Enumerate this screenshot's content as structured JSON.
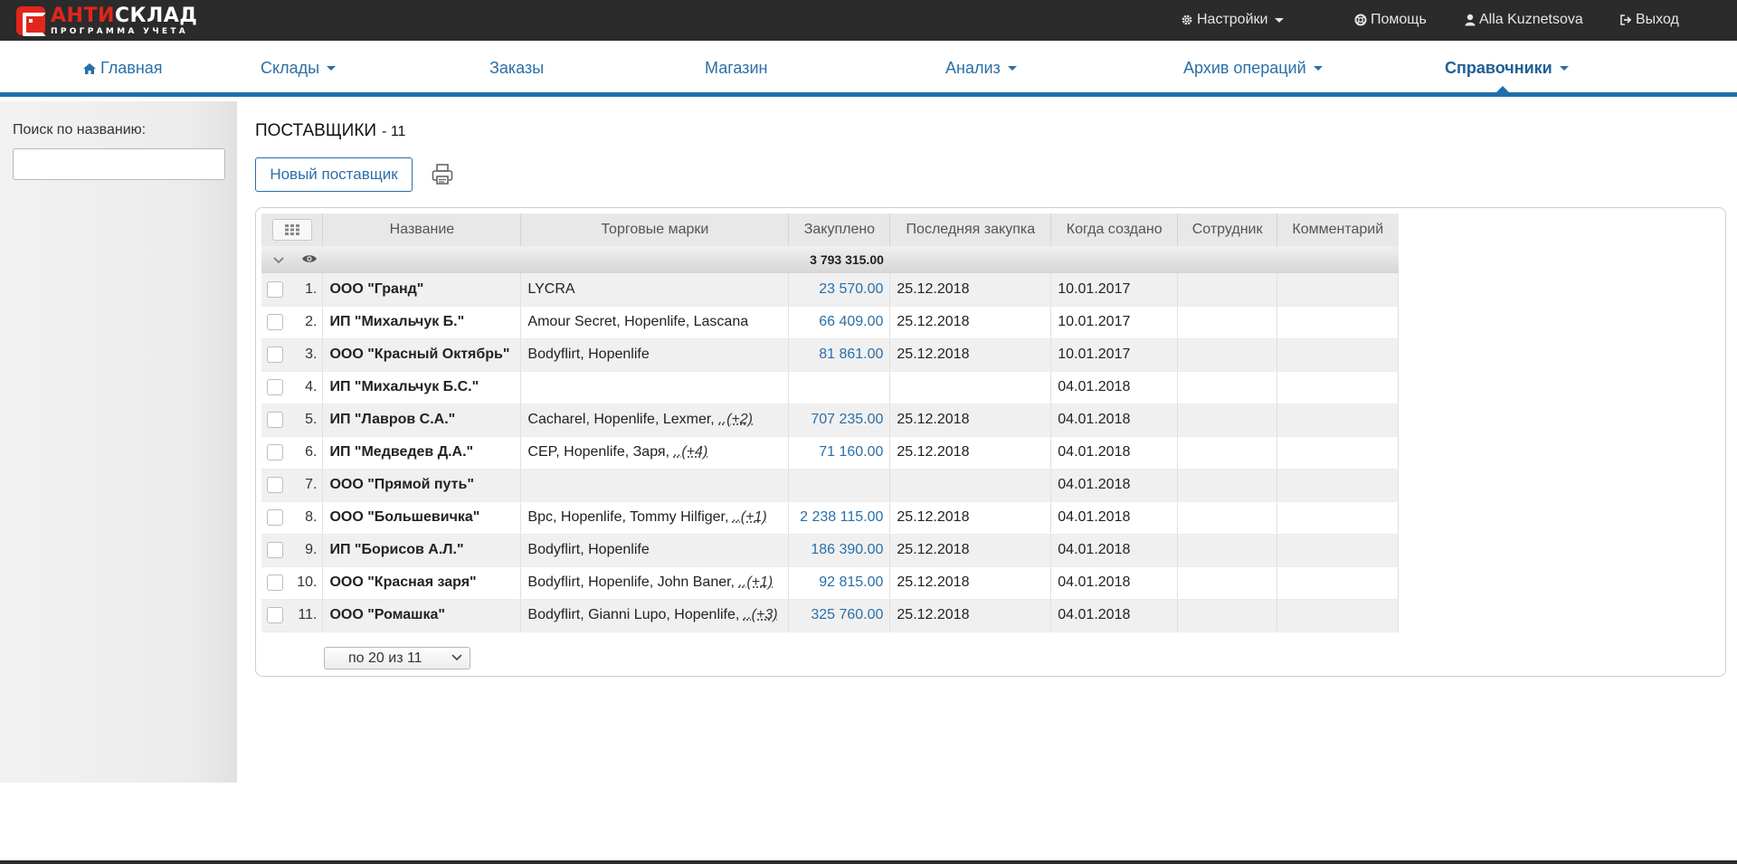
{
  "app": {
    "logo_name_accent": "АНТИ",
    "logo_name_rest": "СКЛАД",
    "logo_subtitle": "ПРОГРАММА УЧЕТА"
  },
  "topbar": {
    "settings": "Настройки",
    "help": "Помощь",
    "user": "Alla Kuznetsova",
    "logout": "Выход"
  },
  "nav": {
    "home": "Главная",
    "warehouses": "Склады",
    "orders": "Заказы",
    "shop": "Магазин",
    "analysis": "Анализ",
    "archive": "Архив операций",
    "references": "Справочники"
  },
  "sidebar": {
    "search_label": "Поиск по названию:",
    "search_value": ""
  },
  "main": {
    "title": "ПОСТАВЩИКИ",
    "count": "- 11",
    "new_button": "Новый поставщик",
    "total": "3 793 315.00",
    "pager": "по 20 из 11"
  },
  "table": {
    "columns": {
      "name": "Название",
      "brands": "Торговые марки",
      "purchased": "Закуплено",
      "last": "Последняя закупка",
      "created": "Когда создано",
      "employee": "Сотрудник",
      "comment": "Комментарий"
    },
    "rows": [
      {
        "num": "1.",
        "name": "ООО \"Гранд\"",
        "brands": "LYCRA",
        "more": "",
        "amount": "23 570.00",
        "last": "25.12.2018",
        "created": "10.01.2017",
        "employee": "",
        "comment": ""
      },
      {
        "num": "2.",
        "name": "ИП \"Михальчук Б.\"",
        "brands": "Amour Secret, Hopenlife, Lascana",
        "more": "",
        "amount": "66 409.00",
        "last": "25.12.2018",
        "created": "10.01.2017",
        "employee": "",
        "comment": ""
      },
      {
        "num": "3.",
        "name": "ООО \"Красный Октябрь\"",
        "brands": "Bodyflirt, Hopenlife",
        "more": "",
        "amount": "81 861.00",
        "last": "25.12.2018",
        "created": "10.01.2017",
        "employee": "",
        "comment": ""
      },
      {
        "num": "4.",
        "name": "ИП \"Михальчук Б.С.\"",
        "brands": "",
        "more": "",
        "amount": "",
        "last": "",
        "created": "04.01.2018",
        "employee": "",
        "comment": ""
      },
      {
        "num": "5.",
        "name": "ИП \"Лавров С.А.\"",
        "brands": "Cacharel, Hopenlife, Lexmer, ",
        "more": "..(+2)",
        "amount": "707 235.00",
        "last": "25.12.2018",
        "created": "04.01.2018",
        "employee": "",
        "comment": ""
      },
      {
        "num": "6.",
        "name": "ИП \"Медведев Д.А.\"",
        "brands": "CEP, Hopenlife, Заря, ",
        "more": "..(+4)",
        "amount": "71 160.00",
        "last": "25.12.2018",
        "created": "04.01.2018",
        "employee": "",
        "comment": ""
      },
      {
        "num": "7.",
        "name": "ООО \"Прямой путь\"",
        "brands": "",
        "more": "",
        "amount": "",
        "last": "",
        "created": "04.01.2018",
        "employee": "",
        "comment": ""
      },
      {
        "num": "8.",
        "name": "ООО \"Большевичка\"",
        "brands": "Bpc, Hopenlife, Tommy Hilfiger, ",
        "more": "..(+1)",
        "amount": "2 238 115.00",
        "last": "25.12.2018",
        "created": "04.01.2018",
        "employee": "",
        "comment": ""
      },
      {
        "num": "9.",
        "name": "ИП \"Борисов А.Л.\"",
        "brands": "Bodyflirt, Hopenlife",
        "more": "",
        "amount": "186 390.00",
        "last": "25.12.2018",
        "created": "04.01.2018",
        "employee": "",
        "comment": ""
      },
      {
        "num": "10.",
        "name": "ООО \"Красная заря\"",
        "brands": "Bodyflirt, Hopenlife, John Baner, ",
        "more": "..(+1)",
        "amount": "92 815.00",
        "last": "25.12.2018",
        "created": "04.01.2018",
        "employee": "",
        "comment": ""
      },
      {
        "num": "11.",
        "name": "ООО \"Ромашка\"",
        "brands": "Bodyflirt, Gianni Lupo, Hopenlife, ",
        "more": "..(+3)",
        "amount": "325 760.00",
        "last": "25.12.2018",
        "created": "04.01.2018",
        "employee": "",
        "comment": ""
      }
    ]
  }
}
